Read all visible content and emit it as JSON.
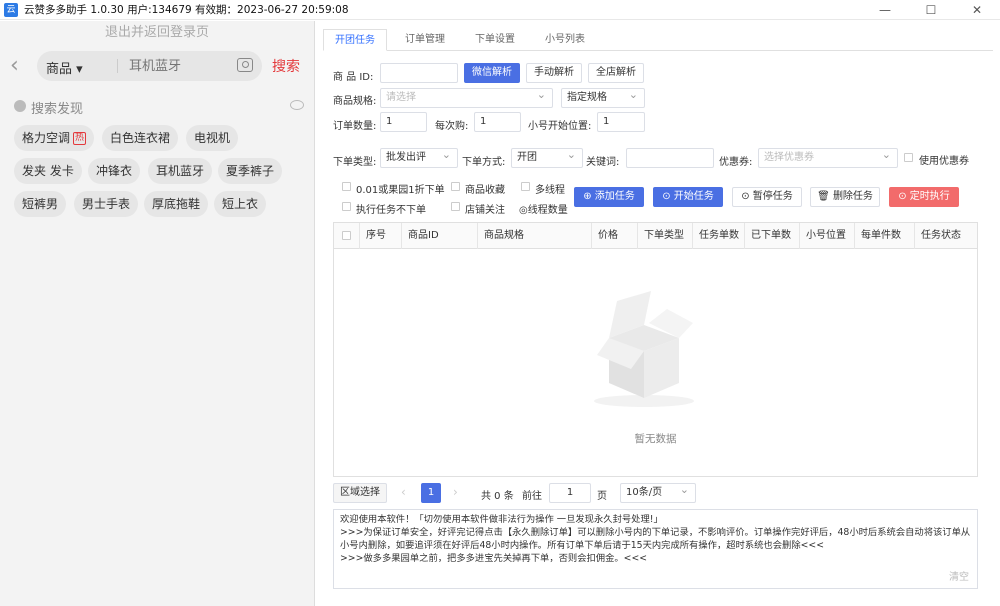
{
  "window": {
    "title": "云赞多多助手 1.0.30 用户:134679 有效期：2023-06-27 20:59:08"
  },
  "left": {
    "logout": "退出并返回登录页",
    "search": {
      "category": "商品",
      "placeholder": "耳机蓝牙",
      "button": "搜索"
    },
    "discover_label": "搜索发现",
    "tags": [
      "格力空调",
      "白色连衣裙",
      "电视机",
      "发夹 发卡",
      "冲锋衣",
      "耳机蓝牙",
      "夏季裤子",
      "短裤男",
      "男士手表",
      "厚底拖鞋",
      "短上衣"
    ],
    "hot_badge": "热"
  },
  "tabs": [
    "开团任务",
    "订单管理",
    "下单设置",
    "小号列表"
  ],
  "form": {
    "product_id_label": "商 品 ID:",
    "product_id_value": "",
    "btn_wechat_parse": "微信解析",
    "btn_manual_parse": "手动解析",
    "btn_store_parse": "全店解析",
    "spec_label": "商品规格:",
    "spec_placeholder": "请选择",
    "spec_mode": "指定规格",
    "order_qty_label": "订单数量:",
    "order_qty": "1",
    "per_buy_label": "每次购:",
    "per_buy": "1",
    "start_pos_label": "小号开始位置:",
    "start_pos": "1",
    "order_type_label": "下单类型:",
    "order_type": "批发出评",
    "order_mode_label": "下单方式:",
    "order_mode": "开团",
    "keyword_label": "关键词:",
    "keyword": "",
    "coupon_label": "优惠券:",
    "coupon_placeholder": "选择优惠券",
    "use_coupon": "使用优惠券"
  },
  "options": {
    "opt1": "0.01或果园1折下单",
    "opt2": "商品收藏",
    "opt3": "多线程",
    "opt4": "执行任务不下单",
    "opt5": "店铺关注",
    "opt6": "◎线程数量"
  },
  "actions": {
    "add": "添加任务",
    "start": "开始任务",
    "pause": "暂停任务",
    "delete": "删除任务",
    "schedule": "定时执行"
  },
  "table": {
    "headers": [
      "序号",
      "商品ID",
      "商品规格",
      "价格",
      "下单类型",
      "任务单数",
      "已下单数",
      "小号位置",
      "每单件数",
      "任务状态"
    ],
    "empty": "暂无数据"
  },
  "pager": {
    "region": "区域选择",
    "current": "1",
    "total": "共 0 条",
    "goto": "前往",
    "goto_value": "1",
    "page_unit": "页",
    "page_size": "10条/页"
  },
  "log": {
    "lines": [
      "欢迎使用本软件！「切勿使用本软件做非法行为操作 一旦发现永久封号处理!」",
      ">>>为保证订单安全，好评完记得点击【永久删除订单】可以删除小号内的下单记录，不影响评价。订单操作完好评后，48小时后系统会自动将该订单从",
      "小号内删除，如要追评须在好评后48小时内操作。所有订单下单后请于15天内完成所有操作，超时系统也会删除<<<",
      ">>>做多多果园单之前，把多多进宝先关掉再下单，否则会扣佣金。<<<"
    ],
    "clear": "清空"
  },
  "colors": {
    "primary": "#4a6fe3",
    "danger": "#f26b6b",
    "accent_red": "#e4393c"
  }
}
